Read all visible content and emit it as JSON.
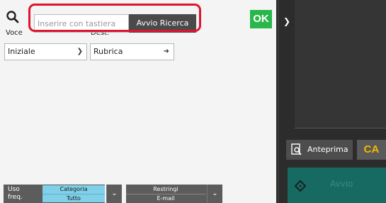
{
  "search": {
    "placeholder": "Inserire con tastiera",
    "button_label": "Avvio Ricerca"
  },
  "ok_label": "OK",
  "fields": {
    "voce_label": "Voce",
    "dest_label": "Dest.",
    "voce_value": "Iniziale",
    "dest_value": "Rubrica"
  },
  "bottom_bar": {
    "uso_freq_label": "Uso\nfreq.",
    "categoria_label": "Categoria",
    "categoria_value": "Tutto",
    "restringi_label": "Restringi",
    "restringi_value": "E-mail"
  },
  "right_panel": {
    "anteprima_label": "Anteprima",
    "ca_label": "CA",
    "avvio_label": "Avvio"
  },
  "colors": {
    "highlight": "#e0142d",
    "ok": "#29b64b",
    "category_accent": "#7fd0e8",
    "start_button": "#166a62",
    "ca_text": "#f5b800"
  },
  "icons": {
    "search": "search-icon",
    "expand": "chevron-right-icon",
    "preview": "preview-icon",
    "start": "start-icon"
  }
}
